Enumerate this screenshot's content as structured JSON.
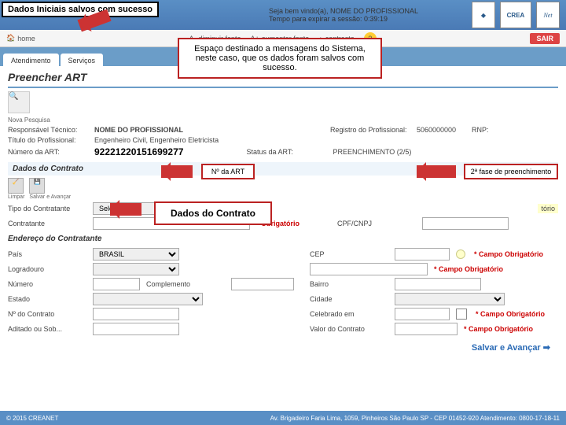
{
  "success_message": "Dados Iniciais salvos com sucesso",
  "header": {
    "welcome": "Seja bem vindo(a), NOME DO PROFISSIONAL",
    "session_timer": "Tempo para expirar a sessão: 0:39:19",
    "logo_crea": "CREA",
    "logo_net": "Net"
  },
  "toolbar": {
    "home": "home",
    "reduce_font": "diminuir fonte",
    "increase_font": "aumentar fonte",
    "contrast": "contraste",
    "help": "?",
    "exit": "SAIR"
  },
  "tabs": {
    "atendimento": "Atendimento",
    "servicos": "Serviços"
  },
  "page_title": "Preencher ART",
  "nova_pesquisa": "Nova Pesquisa",
  "prof_info": {
    "resp_label": "Responsável Técnico:",
    "resp_value": "NOME DO PROFISSIONAL",
    "reg_label": "Registro do Profissional:",
    "reg_value": "5060000000",
    "rnp_label": "RNP:",
    "titulo_label": "Título do Profissional:",
    "titulo_value": "Engenheiro Civil, Engenheiro Eletricista",
    "art_label": "Número da ART:",
    "art_value": "92221220151699277",
    "status_label": "Status da ART:",
    "status_value": "PREENCHIMENTO (2/5)"
  },
  "annotations": {
    "main": "Espaço destinado a mensagens do Sistema, neste caso, que os dados foram salvos com sucesso.",
    "art": "Nº da ART",
    "fase": "2ª fase de preenchimento",
    "contrato": "Dados do Contrato"
  },
  "section_contrato": "Dados do Contrato",
  "mini": {
    "limpar": "Limpar",
    "salvar": "Salvar e Avançar"
  },
  "form": {
    "tipo_contratante": "Tipo do Contratante",
    "selecione": "Selecione",
    "campo": "Campo",
    "obrigatorio": "Obrigatório",
    "contratante": "Contratante",
    "cpfcnpj": "CPF/CNPJ",
    "endereco_header": "Endereço do Contratante",
    "pais": "País",
    "pais_val": "BRASIL",
    "cep": "CEP",
    "campo_obrig": "Campo Obrigatório",
    "logradouro": "Logradouro",
    "numero": "Número",
    "complemento": "Complemento",
    "bairro": "Bairro",
    "estado": "Estado",
    "cidade": "Cidade",
    "n_contrato": "Nº do Contrato",
    "celebrado": "Celebrado em",
    "aditado": "Aditado ou Sob...",
    "valor": "Valor do Contrato"
  },
  "save_advance": "Salvar e Avançar",
  "footer": {
    "copy": "© 2015 CREANET",
    "addr": "Av. Brigadeiro Faria Lima, 1059, Pinheiros São Paulo SP - CEP 01452-920 Atendimento: 0800-17-18-11"
  }
}
